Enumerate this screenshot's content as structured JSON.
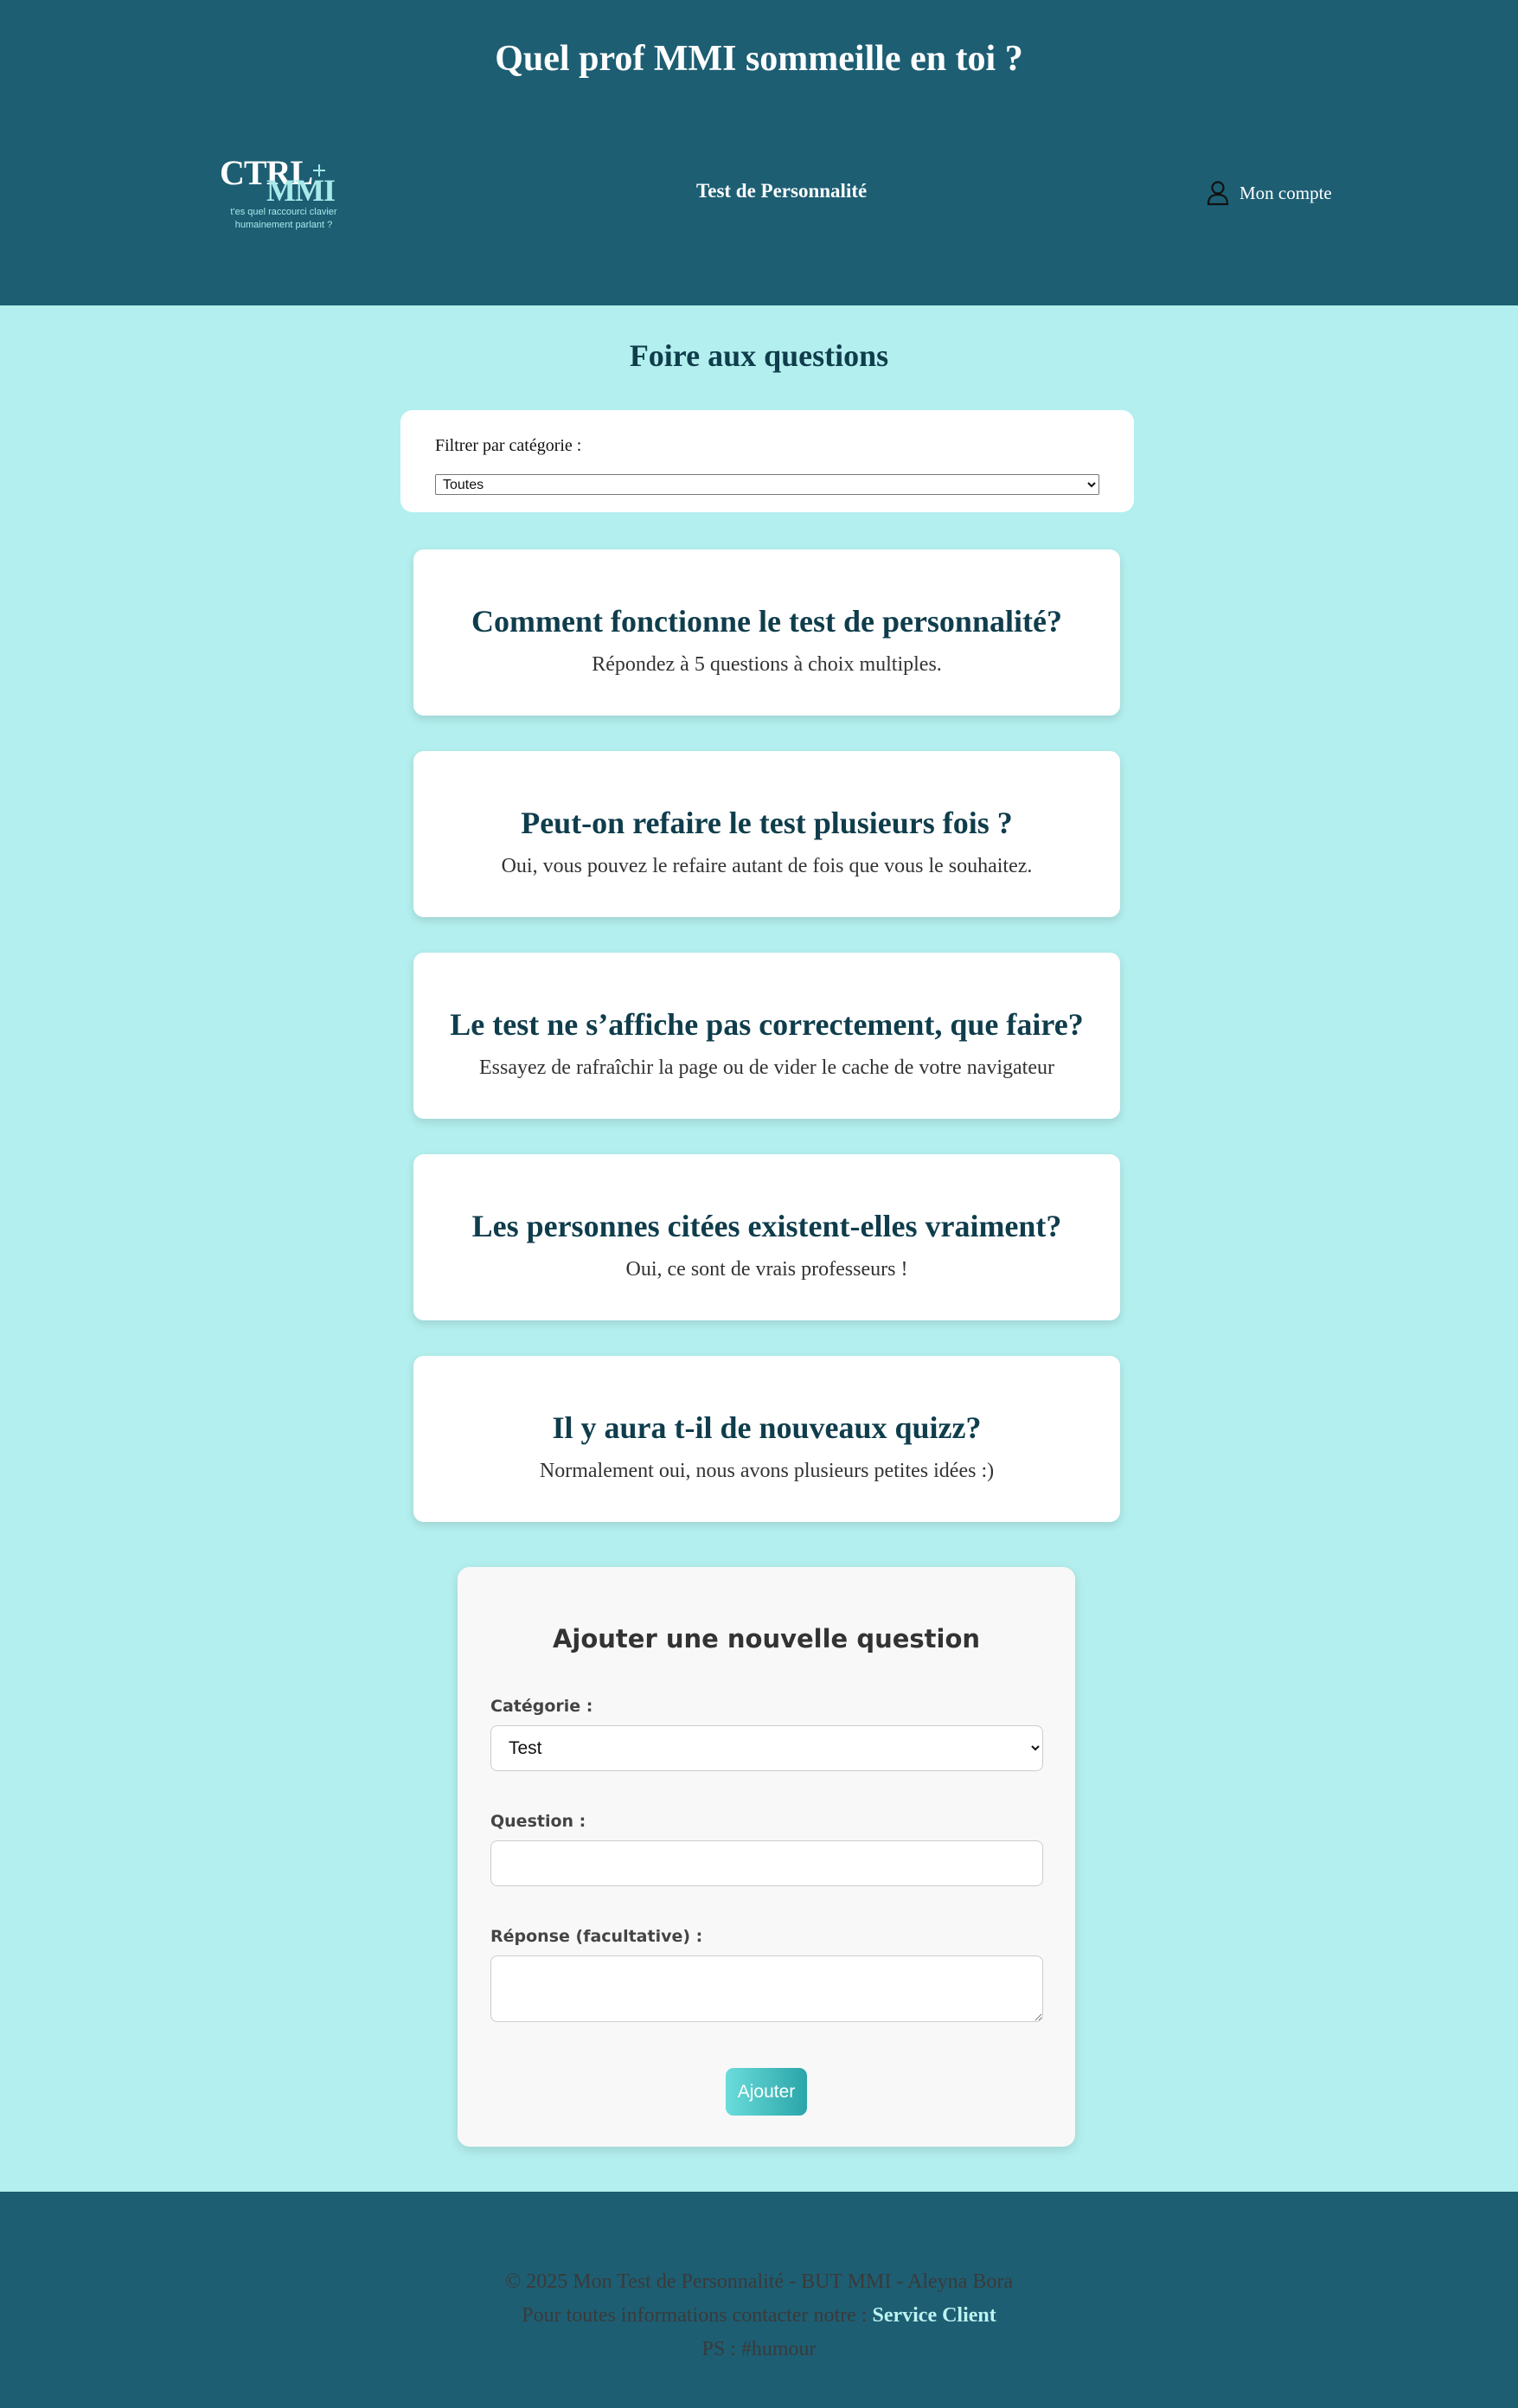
{
  "header": {
    "site_title": "Quel prof MMI sommeille en toi ?",
    "logo": {
      "ctrl": "CTRL",
      "mmi": "MMI",
      "tagline_line1": "t'es quel raccourci clavier",
      "tagline_line2": "humainement parlant ?"
    },
    "nav_link": "Test de Personnalité",
    "account_label": "Mon compte",
    "account_icon": "user-icon"
  },
  "faq": {
    "title": "Foire aux questions",
    "filter": {
      "label": "Filtrer par catégorie :",
      "selected": "Toutes"
    },
    "items": [
      {
        "question": "Comment fonctionne le test de personnalité?",
        "answer": "Répondez à 5 questions à choix multiples."
      },
      {
        "question": "Peut-on refaire le test plusieurs fois ?",
        "answer": "Oui, vous pouvez le refaire autant de fois que vous le souhaitez."
      },
      {
        "question": "Le test ne s’affiche pas correctement, que faire?",
        "answer": "Essayez de rafraîchir la page ou de vider le cache de votre navigateur"
      },
      {
        "question": "Les personnes citées existent-elles vraiment?",
        "answer": "Oui, ce sont de vrais professeurs !"
      },
      {
        "question": "Il y aura t-il de nouveaux quizz?",
        "answer": "Normalement oui, nous avons plusieurs petites idées :)"
      }
    ]
  },
  "form": {
    "title": "Ajouter une nouvelle question",
    "category_label": "Catégorie :",
    "category_selected": "Test",
    "question_label": "Question :",
    "question_value": "",
    "answer_label": "Réponse (facultative) :",
    "answer_value": "",
    "submit_label": "Ajouter"
  },
  "footer": {
    "copyright": "© 2025 Mon Test de Personnalité - BUT MMI - Aleyna Bora",
    "contact_prefix": "Pour toutes informations contacter notre :",
    "contact_link": "Service Client",
    "ps": "PS : #humour"
  },
  "colors": {
    "header_bg": "#1d5e73",
    "page_bg": "#b3efee",
    "heading": "#0f3d4c",
    "accent": "#2aa5a8"
  }
}
